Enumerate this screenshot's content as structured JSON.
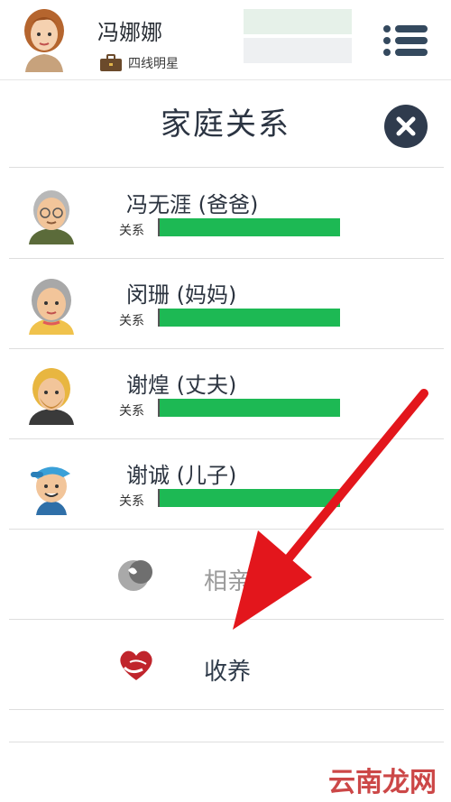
{
  "header": {
    "player_name": "冯娜娜",
    "career_label": "四线明星"
  },
  "page": {
    "title": "家庭关系"
  },
  "family": [
    {
      "name": "冯无涯 (爸爸)",
      "relation_label": "关系",
      "relation_level": 1.0
    },
    {
      "name": "闵珊 (妈妈)",
      "relation_label": "关系",
      "relation_level": 1.0
    },
    {
      "name": "谢煌 (丈夫)",
      "relation_label": "关系",
      "relation_level": 1.0
    },
    {
      "name": "谢诚 (儿子)",
      "relation_label": "关系",
      "relation_level": 1.0
    }
  ],
  "options": [
    {
      "label": "相亲",
      "state": "disabled",
      "icon": "date-hearts-icon"
    },
    {
      "label": "收养",
      "state": "enabled",
      "icon": "adopt-heart-icon"
    }
  ],
  "colors": {
    "relation_bar": "#1db954",
    "accent_dark": "#2f3b4d",
    "annotation_arrow": "#e3161c",
    "disabled_text": "#9a9a9a"
  },
  "watermark": {
    "text": "云南龙网"
  }
}
